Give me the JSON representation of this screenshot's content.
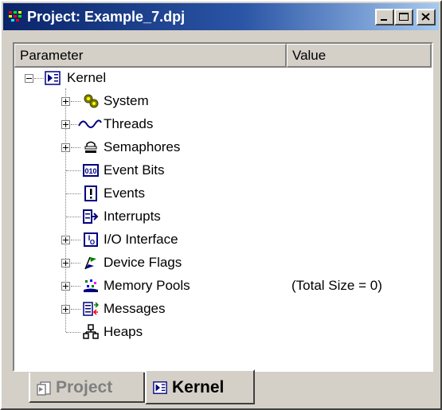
{
  "window": {
    "title": "Project: Example_7.dpj",
    "buttons": [
      "minimize",
      "maximize",
      "close"
    ]
  },
  "columns": {
    "parameter": "Parameter",
    "value": "Value"
  },
  "tree": {
    "root": {
      "label": "Kernel",
      "icon": "kernel-icon",
      "expanded": true
    },
    "items": [
      {
        "label": "System",
        "icon": "system-icon",
        "expandable": true,
        "value": ""
      },
      {
        "label": "Threads",
        "icon": "threads-icon",
        "expandable": true,
        "value": ""
      },
      {
        "label": "Semaphores",
        "icon": "semaphores-icon",
        "expandable": true,
        "value": ""
      },
      {
        "label": "Event Bits",
        "icon": "event-bits-icon",
        "expandable": false,
        "value": ""
      },
      {
        "label": "Events",
        "icon": "events-icon",
        "expandable": false,
        "value": ""
      },
      {
        "label": "Interrupts",
        "icon": "interrupts-icon",
        "expandable": false,
        "value": ""
      },
      {
        "label": "I/O Interface",
        "icon": "io-interface-icon",
        "expandable": true,
        "value": ""
      },
      {
        "label": "Device Flags",
        "icon": "device-flags-icon",
        "expandable": true,
        "value": ""
      },
      {
        "label": "Memory Pools",
        "icon": "memory-pools-icon",
        "expandable": true,
        "value": "(Total Size = 0)"
      },
      {
        "label": "Messages",
        "icon": "messages-icon",
        "expandable": true,
        "value": ""
      },
      {
        "label": "Heaps",
        "icon": "heaps-icon",
        "expandable": false,
        "value": ""
      }
    ]
  },
  "tabs": [
    {
      "label": "Project",
      "icon": "project-icon",
      "active": false
    },
    {
      "label": "Kernel",
      "icon": "kernel-icon",
      "active": true
    }
  ],
  "colors": {
    "title_start": "#0a246a",
    "title_end": "#a6caf0",
    "face": "#d4d0c8",
    "inactive_tab_text": "#808080"
  }
}
